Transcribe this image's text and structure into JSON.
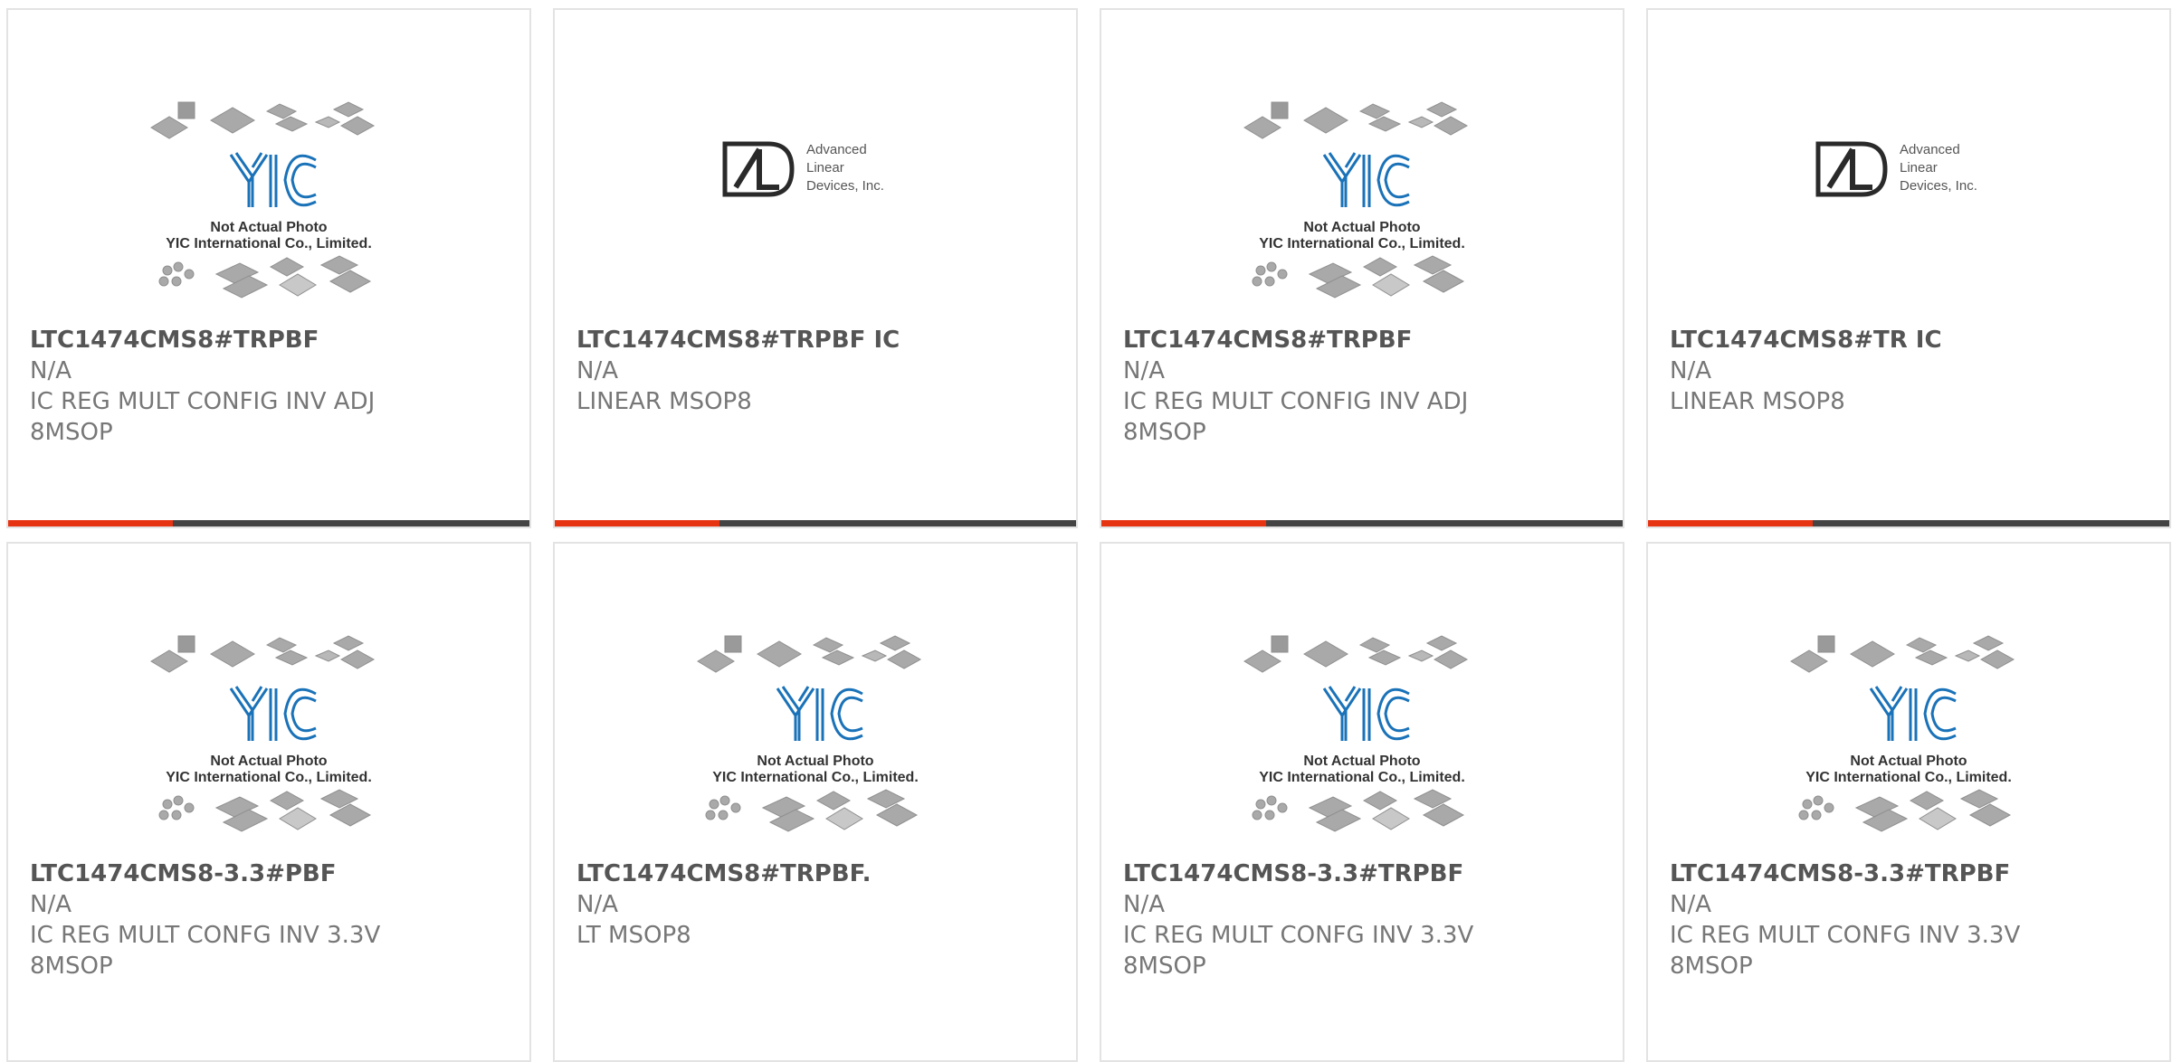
{
  "colors": {
    "accent": "#e63312",
    "bar": "#444444",
    "card_border": "#e3e3e3",
    "title_text": "#555555",
    "body_text": "#777777",
    "yic_blue": "#1a72b8"
  },
  "yic_image": {
    "logo_text": "YIC",
    "caption1": "Not Actual Photo",
    "caption2": "YIC International Co., Limited."
  },
  "ald_image": {
    "line1": "Advanced",
    "line2": "Linear",
    "line3": "Devices, Inc."
  },
  "products": [
    {
      "image": "yic",
      "part_number": "LTC1474CMS8#TRPBF",
      "stock": "N/A",
      "description": "IC REG MULT CONFIG INV ADJ 8MSOP"
    },
    {
      "image": "ald",
      "part_number": "LTC1474CMS8#TRPBF IC",
      "stock": "N/A",
      "description": "LINEAR MSOP8"
    },
    {
      "image": "yic",
      "part_number": "LTC1474CMS8#TRPBF",
      "stock": "N/A",
      "description": "IC REG MULT CONFIG INV ADJ 8MSOP"
    },
    {
      "image": "ald",
      "part_number": "LTC1474CMS8#TR IC",
      "stock": "N/A",
      "description": "LINEAR MSOP8"
    },
    {
      "image": "yic",
      "part_number": "LTC1474CMS8-3.3#PBF",
      "stock": "N/A",
      "description": "IC REG MULT CONFG INV 3.3V 8MSOP"
    },
    {
      "image": "yic",
      "part_number": "LTC1474CMS8#TRPBF.",
      "stock": "N/A",
      "description": "LT MSOP8"
    },
    {
      "image": "yic",
      "part_number": "LTC1474CMS8-3.3#TRPBF",
      "stock": "N/A",
      "description": "IC REG MULT CONFG INV 3.3V 8MSOP"
    },
    {
      "image": "yic",
      "part_number": "LTC1474CMS8-3.3#TRPBF",
      "stock": "N/A",
      "description": "IC REG MULT CONFG INV 3.3V 8MSOP"
    }
  ]
}
